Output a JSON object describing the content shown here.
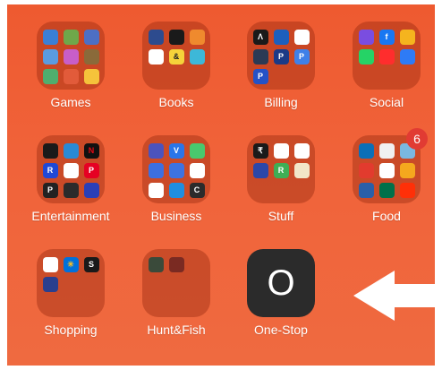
{
  "folders": [
    {
      "label": "Games",
      "icons": [
        {
          "name": "game-app-1-icon",
          "color": "#3b7fd6",
          "glyph": ""
        },
        {
          "name": "game-app-2-icon",
          "color": "#6fa84a",
          "glyph": ""
        },
        {
          "name": "game-app-3-icon",
          "color": "#4d6fc4",
          "glyph": ""
        },
        {
          "name": "game-app-4-icon",
          "color": "#5a9be0",
          "glyph": ""
        },
        {
          "name": "game-app-5-icon",
          "color": "#c85ec8",
          "glyph": ""
        },
        {
          "name": "game-app-6-icon",
          "color": "#8a6a3a",
          "glyph": ""
        },
        {
          "name": "game-app-7-icon",
          "color": "#4fae6e",
          "glyph": ""
        },
        {
          "name": "game-app-8-icon",
          "color": "#e25b3a",
          "glyph": ""
        },
        {
          "name": "game-app-9-icon",
          "color": "#f5c33b",
          "glyph": ""
        }
      ]
    },
    {
      "label": "Books",
      "icons": [
        {
          "name": "books-app-1-icon",
          "color": "#2d4b8e",
          "glyph": ""
        },
        {
          "name": "audible-icon",
          "color": "#1a1a1a",
          "glyph": ""
        },
        {
          "name": "books-app-3-icon",
          "color": "#ef8a2e",
          "glyph": ""
        },
        {
          "name": "books-app-4-icon",
          "color": "#ffffff",
          "glyph": ""
        },
        {
          "name": "books-app-5-icon",
          "color": "#f5d33a",
          "glyph": "&"
        },
        {
          "name": "books-app-6-icon",
          "color": "#3db8d8",
          "glyph": ""
        }
      ]
    },
    {
      "label": "Billing",
      "icons": [
        {
          "name": "billing-app-1-icon",
          "color": "#1a1a1a",
          "glyph": "Λ"
        },
        {
          "name": "billing-app-2-icon",
          "color": "#1d5fbd",
          "glyph": ""
        },
        {
          "name": "cvs-pharmacy-icon",
          "color": "#ffffff",
          "glyph": ""
        },
        {
          "name": "amazon-icon",
          "color": "#2b3a55",
          "glyph": ""
        },
        {
          "name": "paypal-icon",
          "color": "#1b3a86",
          "glyph": "P"
        },
        {
          "name": "billing-app-6-icon",
          "color": "#3f80e8",
          "glyph": "P"
        },
        {
          "name": "billing-app-7-icon",
          "color": "#2452c6",
          "glyph": "P"
        }
      ]
    },
    {
      "label": "Social",
      "icons": [
        {
          "name": "social-app-1-icon",
          "color": "#7a4de0",
          "glyph": ""
        },
        {
          "name": "facebook-icon",
          "color": "#1877f2",
          "glyph": "f"
        },
        {
          "name": "social-app-3-icon",
          "color": "#f5b41e",
          "glyph": ""
        },
        {
          "name": "whatsapp-icon",
          "color": "#25d366",
          "glyph": ""
        },
        {
          "name": "youtube-icon",
          "color": "#ff2d2d",
          "glyph": ""
        },
        {
          "name": "messenger-icon",
          "color": "#2e7bf6",
          "glyph": ""
        }
      ]
    },
    {
      "label": "Entertainment",
      "icons": [
        {
          "name": "hulu-icon",
          "color": "#1a1a1a",
          "glyph": ""
        },
        {
          "name": "prime-video-icon",
          "color": "#2a8ad6",
          "glyph": ""
        },
        {
          "name": "netflix-icon",
          "color": "#111111",
          "glyph": "N"
        },
        {
          "name": "entertainment-app-4-icon",
          "color": "#1f48d6",
          "glyph": "R"
        },
        {
          "name": "entertainment-app-5-icon",
          "color": "#ffffff",
          "glyph": ""
        },
        {
          "name": "pinterest-icon",
          "color": "#e60023",
          "glyph": "P"
        },
        {
          "name": "entertainment-app-7-icon",
          "color": "#222222",
          "glyph": "P"
        },
        {
          "name": "entertainment-app-8-icon",
          "color": "#2b2b2b",
          "glyph": ""
        },
        {
          "name": "entertainment-app-9-icon",
          "color": "#2a3fb8",
          "glyph": ""
        }
      ]
    },
    {
      "label": "Business",
      "icons": [
        {
          "name": "teams-icon",
          "color": "#4b53bc",
          "glyph": ""
        },
        {
          "name": "business-app-2-icon",
          "color": "#2a75e8",
          "glyph": "V"
        },
        {
          "name": "business-app-3-icon",
          "color": "#49c96e",
          "glyph": ""
        },
        {
          "name": "business-app-4-icon",
          "color": "#3c6fe0",
          "glyph": ""
        },
        {
          "name": "business-app-5-icon",
          "color": "#3e73e0",
          "glyph": ""
        },
        {
          "name": "google-maps-icon",
          "color": "#ffffff",
          "glyph": ""
        },
        {
          "name": "google-drive-icon",
          "color": "#ffffff",
          "glyph": ""
        },
        {
          "name": "business-app-8-icon",
          "color": "#1f8ee0",
          "glyph": ""
        },
        {
          "name": "business-app-9-icon",
          "color": "#2b2b2b",
          "glyph": "C"
        }
      ]
    },
    {
      "label": "Stuff",
      "icons": [
        {
          "name": "stuff-app-1-icon",
          "color": "#1a1a1a",
          "glyph": "₹"
        },
        {
          "name": "stuff-app-2-icon",
          "color": "#ffffff",
          "glyph": ""
        },
        {
          "name": "stuff-app-3-icon",
          "color": "#ffffff",
          "glyph": ""
        },
        {
          "name": "stuff-app-4-icon",
          "color": "#2c47a8",
          "glyph": ""
        },
        {
          "name": "stuff-app-5-icon",
          "color": "#3fae55",
          "glyph": "R"
        },
        {
          "name": "stuff-app-6-icon",
          "color": "#f2e6c8",
          "glyph": ""
        }
      ]
    },
    {
      "label": "Food",
      "badge": "6",
      "icons": [
        {
          "name": "dominos-icon",
          "color": "#0b6fb8",
          "glyph": ""
        },
        {
          "name": "food-app-2-icon",
          "color": "#f0f0f0",
          "glyph": ""
        },
        {
          "name": "food-app-3-icon",
          "color": "#7ab8e0",
          "glyph": ""
        },
        {
          "name": "food-app-4-icon",
          "color": "#e23b2e",
          "glyph": ""
        },
        {
          "name": "food-app-5-icon",
          "color": "#ffffff",
          "glyph": ""
        },
        {
          "name": "food-app-6-icon",
          "color": "#f5a81e",
          "glyph": ""
        },
        {
          "name": "food-app-7-icon",
          "color": "#2a5fa8",
          "glyph": ""
        },
        {
          "name": "starbucks-icon",
          "color": "#00704a",
          "glyph": ""
        },
        {
          "name": "doordash-icon",
          "color": "#ff3008",
          "glyph": ""
        }
      ]
    },
    {
      "label": "Shopping",
      "icons": [
        {
          "name": "shopping-app-1-icon",
          "color": "#ffffff",
          "glyph": ""
        },
        {
          "name": "walmart-icon",
          "color": "#0071dc",
          "glyph": "✳"
        },
        {
          "name": "shopping-app-3-icon",
          "color": "#1a1a1a",
          "glyph": "S"
        },
        {
          "name": "shopping-app-4-icon",
          "color": "#2a3f8e",
          "glyph": ""
        }
      ]
    },
    {
      "label": "Hunt&Fish",
      "icons": [
        {
          "name": "hunt-fish-app-1-icon",
          "color": "#3a4a3a",
          "glyph": ""
        },
        {
          "name": "hunt-fish-app-2-icon",
          "color": "#7a2a22",
          "glyph": ""
        }
      ]
    }
  ],
  "onestop": {
    "label": "One-Stop",
    "glyph": "O"
  },
  "arrow": {
    "color": "#ffffff"
  }
}
